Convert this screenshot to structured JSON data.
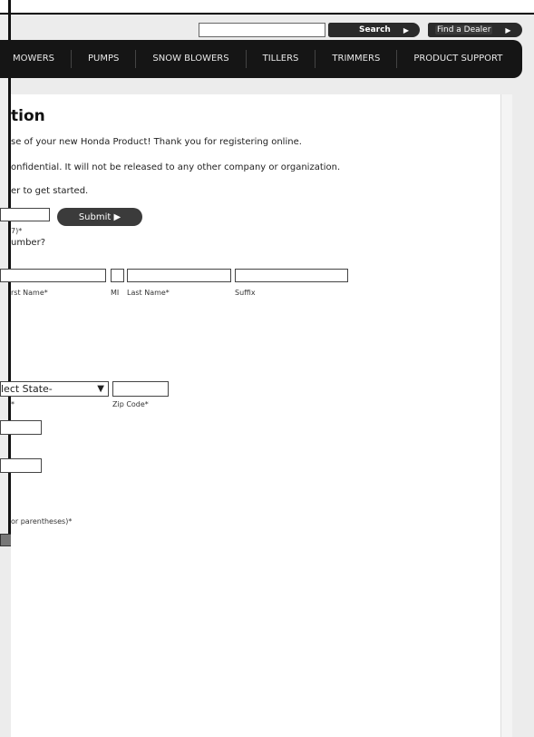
{
  "header": {
    "search_placeholder": "",
    "search_label": "Search",
    "search_arrow": "▶",
    "dealer_label": "Find a Dealer",
    "dealer_arrow": "▶"
  },
  "nav": {
    "items": [
      "MOWERS",
      "PUMPS",
      "SNOW BLOWERS",
      "TILLERS",
      "TRIMMERS",
      "PRODUCT SUPPORT"
    ]
  },
  "content": {
    "title": "tion",
    "line1": "se of your new Honda Product! Thank you for registering online.",
    "line2": "onfidential. It will not be released to any other company or organization.",
    "line3": "er to get started.",
    "serial_hint": "7)*",
    "serial_question": "umber?",
    "submit_label": "Submit ▶",
    "first_name_label": "rst Name*",
    "mi_label": "MI",
    "last_name_label": "Last Name*",
    "suffix_label": "Suffix",
    "state_select": "lect State-",
    "state_label": "*",
    "zip_label": "Zip Code*",
    "phone_hint": "or parentheses)*"
  }
}
